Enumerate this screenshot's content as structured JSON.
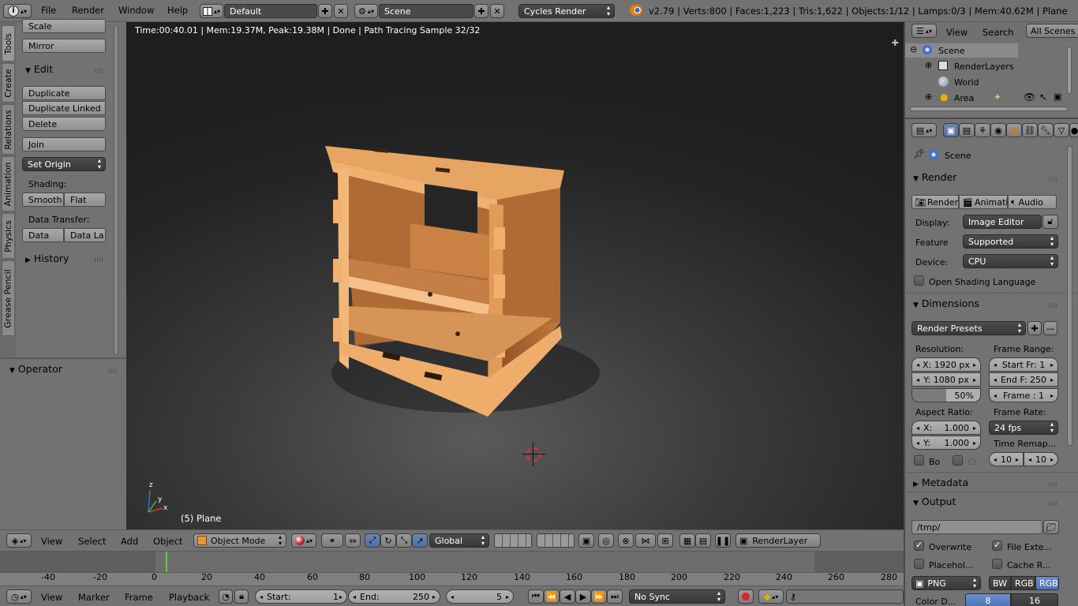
{
  "top": {
    "menus": [
      "File",
      "Render",
      "Window",
      "Help"
    ],
    "screen_layout": "Default",
    "scene": "Scene",
    "engine": "Cycles Render",
    "stats": "v2.79 | Verts:800 | Faces:1,223 | Tris:1,622 | Objects:1/12 | Lamps:0/3 | Mem:40.62M | Plane"
  },
  "tools": {
    "tabs": [
      "Tools",
      "Create",
      "Relations",
      "Animation",
      "Physics",
      "Grease Pencil"
    ],
    "scale": "Scale",
    "mirror": "Mirror",
    "edit_header": "Edit",
    "duplicate": "Duplicate",
    "duplicate_linked": "Duplicate Linked",
    "delete": "Delete",
    "join": "Join",
    "set_origin": "Set Origin",
    "shading_label": "Shading:",
    "smooth": "Smooth",
    "flat": "Flat",
    "data_transfer_label": "Data Transfer:",
    "data": "Data",
    "data_layout": "Data La",
    "history_header": "History",
    "operator_header": "Operator"
  },
  "viewport": {
    "render_info": "Time:00:40.01 | Mem:19.37M, Peak:19.38M | Done | Path Tracing Sample 32/32",
    "object_label": "(5) Plane",
    "axis_z": "z",
    "axis_y": "y",
    "axis_x": "x"
  },
  "view_header": {
    "view": "View",
    "select": "Select",
    "add": "Add",
    "object": "Object",
    "mode": "Object Mode",
    "orientation": "Global",
    "render_layer": "RenderLayer"
  },
  "timeline": {
    "ticks": [
      "-40",
      "-20",
      "0",
      "20",
      "40",
      "60",
      "80",
      "100",
      "120",
      "140",
      "160",
      "180",
      "200",
      "220",
      "240",
      "260",
      "280"
    ],
    "view": "View",
    "marker": "Marker",
    "frame": "Frame",
    "playback": "Playback",
    "start_label": "Start:",
    "start_value": "1",
    "end_label": "End:",
    "end_value": "250",
    "current_frame": "5",
    "sync": "No Sync"
  },
  "outliner": {
    "view": "View",
    "search": "Search",
    "all_scenes": "All Scenes",
    "items": [
      "Scene",
      "RenderLayers",
      "World",
      "Area"
    ]
  },
  "properties": {
    "context": "Scene",
    "render_header": "Render",
    "render_btn": "Render",
    "animation_btn": "Animati",
    "audio_btn": "Audio",
    "display_label": "Display:",
    "display_value": "Image Editor",
    "feature_label": "Feature",
    "feature_value": "Supported",
    "device_label": "Device:",
    "device_value": "CPU",
    "osl_label": "Open Shading Language",
    "dimensions_header": "Dimensions",
    "render_presets": "Render Presets",
    "resolution_label": "Resolution:",
    "res_x": "X: 1920 px",
    "res_y": "Y: 1080 px",
    "res_pct": "50%",
    "frame_range_label": "Frame Range:",
    "start_fr": "Start Fr:  1",
    "end_f": "End F: 250",
    "frame": "Frame :  1",
    "aspect_label": "Aspect Ratio:",
    "aspect_x_label": "X:",
    "aspect_x": "1.000",
    "aspect_y_label": "Y:",
    "aspect_y": "1.000",
    "frame_rate_label": "Frame Rate:",
    "frame_rate": "24 fps",
    "time_remap_label": "Time Remap...",
    "remap_old": "10",
    "remap_new": "10",
    "border_label": "Bo",
    "crop_label": "Cr",
    "metadata_header": "Metadata",
    "output_header": "Output",
    "output_path": "/tmp/",
    "overwrite": "Overwrite",
    "file_ext": "File Exte...",
    "placeholders": "Placehol...",
    "cache_result": "Cache R...",
    "format": "PNG",
    "bw": "BW",
    "rgb": "RGB",
    "rgba": "RGB",
    "color_depth_label": "Color D...",
    "depth_8": "8",
    "depth_16": "16"
  }
}
